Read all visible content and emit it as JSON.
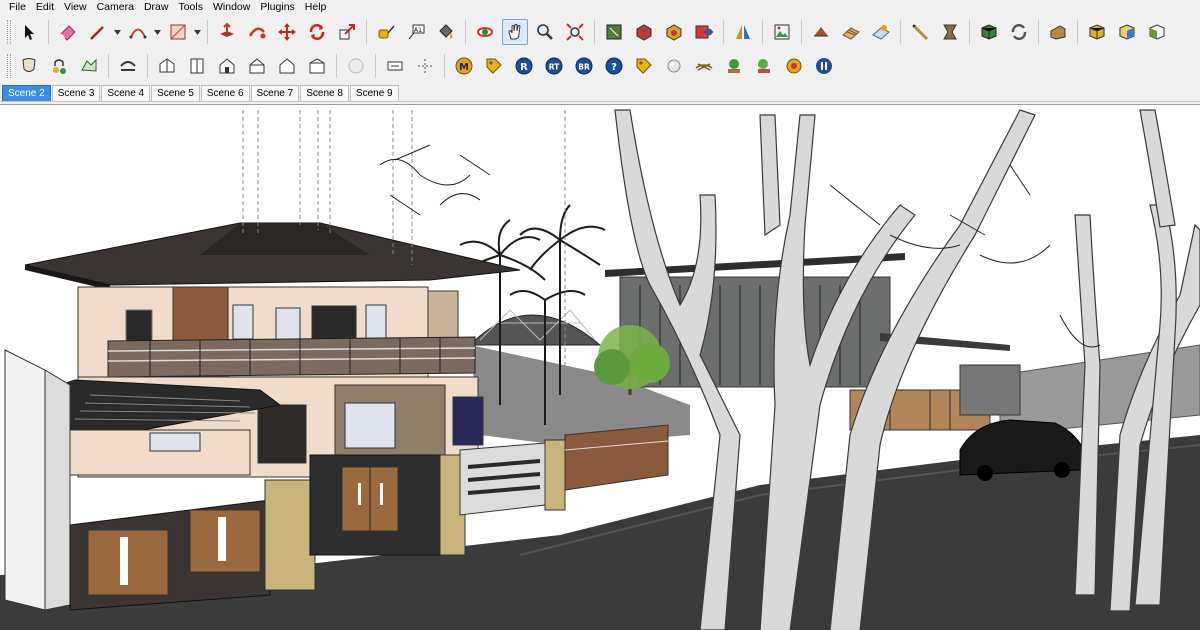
{
  "menu": [
    "File",
    "Edit",
    "View",
    "Camera",
    "Draw",
    "Tools",
    "Window",
    "Plugins",
    "Help"
  ],
  "scenes": {
    "active": "Scene 2",
    "tabs": [
      "Scene 2",
      "Scene 3",
      "Scene 4",
      "Scene 5",
      "Scene 6",
      "Scene 7",
      "Scene 8",
      "Scene 9"
    ]
  },
  "toolbar": {
    "row2_badges": [
      "M",
      "R",
      "RT",
      "BR",
      "?"
    ]
  },
  "colors": {
    "accent": "#3a8de0",
    "sky": "#ffffff",
    "road": "#3b3b3b",
    "roof": "#3a3533",
    "wall_cream": "#efdccb",
    "wall_brown": "#8b5a3c",
    "wood": "#9a6a3e"
  }
}
